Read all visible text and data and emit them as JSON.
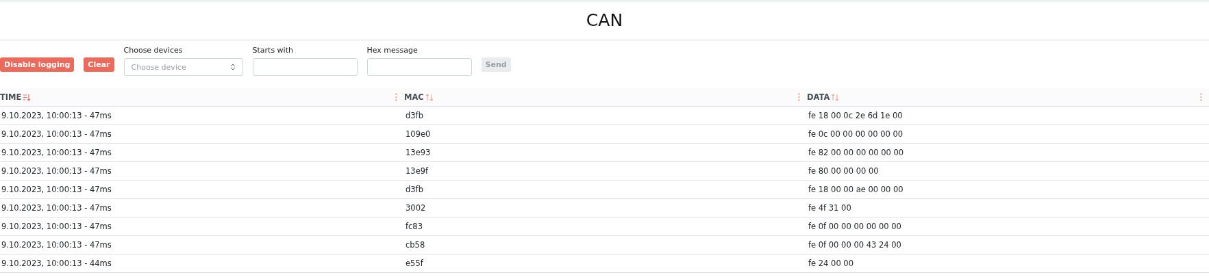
{
  "title": "CAN",
  "controls": {
    "buttons": [
      {
        "label": "Disable logging",
        "disabled": false
      },
      {
        "label": "Clear",
        "disabled": false
      }
    ],
    "device_select": {
      "label": "Choose devices",
      "placeholder": "Choose device"
    },
    "starts_with": {
      "label": "Starts with"
    },
    "hex_message": {
      "label": "Hex message"
    },
    "send": {
      "label": "Send",
      "disabled": true
    }
  },
  "table": {
    "columns": [
      {
        "label": "TIME",
        "sorted": true
      },
      {
        "label": "MAC",
        "sorted": false
      },
      {
        "label": "DATA",
        "sorted": false
      }
    ],
    "rows": [
      [
        "9.10.2023, 10:00:13 - 47ms",
        "d3fb",
        "fe 18 00 0c 2e 6d 1e 00"
      ],
      [
        "9.10.2023, 10:00:13 - 47ms",
        "109e0",
        "fe 0c 00 00 00 00 00 00"
      ],
      [
        "9.10.2023, 10:00:13 - 47ms",
        "13e93",
        "fe 82 00 00 00 00 00 00"
      ],
      [
        "9.10.2023, 10:00:13 - 47ms",
        "13e9f",
        "fe 80 00 00 00 00"
      ],
      [
        "9.10.2023, 10:00:13 - 47ms",
        "d3fb",
        "fe 18 00 00 ae 00 00 00"
      ],
      [
        "9.10.2023, 10:00:13 - 47ms",
        "3002",
        "fe 4f 31 00"
      ],
      [
        "9.10.2023, 10:00:13 - 47ms",
        "fc83",
        "fe 0f 00 00 00 00 00 00"
      ],
      [
        "9.10.2023, 10:00:13 - 47ms",
        "cb58",
        "fe 0f 00 00 00 43 24 00"
      ],
      [
        "9.10.2023, 10:00:13 - 44ms",
        "e55f",
        "fe 24 00 00"
      ]
    ]
  }
}
